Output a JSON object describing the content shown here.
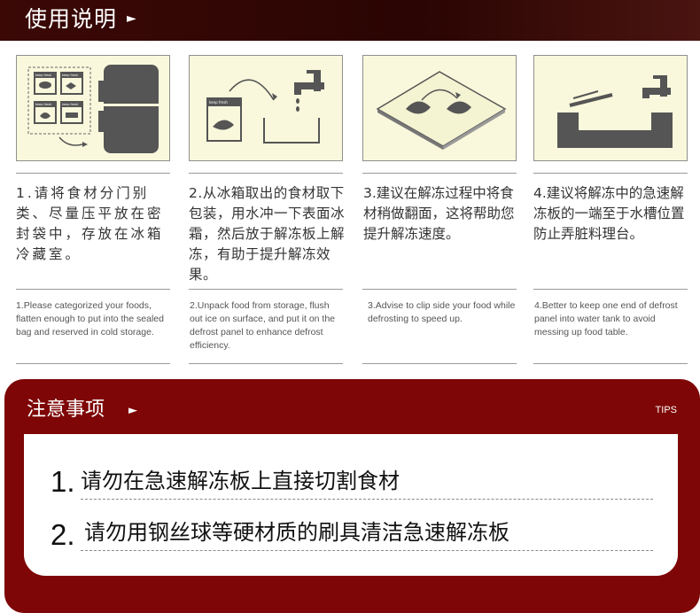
{
  "header": {
    "title": "使用说明",
    "arrow": "►"
  },
  "steps": [
    {
      "cn": "1.请将食材分门别类、尽量压平放在密封袋中，存放在冰箱冷藏室。",
      "en": "1.Please categorized your foods, flatten enough to put into the sealed bag and reserved in cold storage.",
      "bag_labels": [
        "keep fresh",
        "keep fresh",
        "keep fresh",
        "keep fresh"
      ]
    },
    {
      "cn": "2.从冰箱取出的食材取下包装，用水冲一下表面冰霜，然后放于解冻板上解冻，有助于提升解冻效果。",
      "en": "2.Unpack food from storage, flush out ice on surface, and put it on the defrost panel to enhance defrost efficiency.",
      "bag_label": "keep fresh"
    },
    {
      "cn": "3.建议在解冻过程中将食材稍做翻面，这将帮助您提升解冻速度。",
      "en": "3.Advise to clip side your food while defrosting to speed up."
    },
    {
      "cn": "4.建议将解冻中的急速解冻板的一端至于水槽位置防止弄脏料理台。",
      "en": "4.Better to keep one end of defrost panel into water tank to avoid messing up food table."
    }
  ],
  "notice": {
    "title": "注意事项",
    "arrow": "►",
    "tips": "TIPS",
    "rules": [
      {
        "num": "1.",
        "text": "请勿在急速解冻板上直接切割食材"
      },
      {
        "num": "2.",
        "text": "请勿用钢丝球等硬材质的刷具清洁急速解冻板"
      }
    ]
  },
  "colors": {
    "header_bg": "#2a0503",
    "notice_bg": "#7e0606",
    "panel_bg": "#f9f8dc",
    "icon": "#555555"
  }
}
